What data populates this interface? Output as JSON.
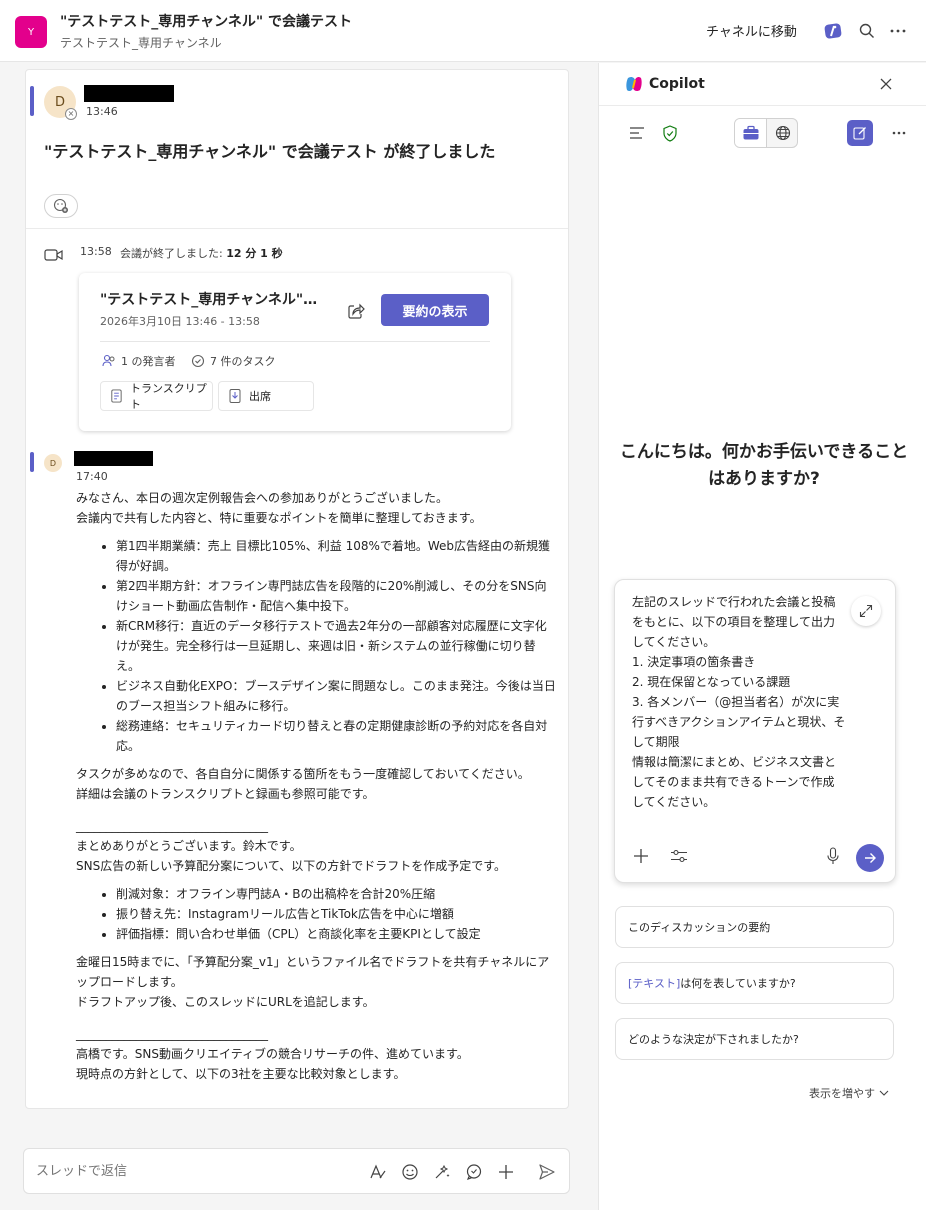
{
  "header": {
    "team_initial": "Y",
    "title": "\"テストテスト_専用チャンネル\" で会議テスト",
    "subtitle": "テストテスト_専用チャンネル",
    "goto_channel": "チャネルに移動"
  },
  "thread": {
    "post1": {
      "avatar_initial": "D",
      "time": "13:46",
      "title": "\"テストテスト_専用チャンネル\" で会議テスト が終了しました"
    },
    "meeting": {
      "time": "13:58",
      "ended_prefix": "会議が終了しました: ",
      "duration": "12 分 1 秒",
      "card": {
        "title": "\"テストテスト_専用チャンネル\" で会議テスト",
        "date": "2026年3月10日 13:46 - 13:58",
        "summary_button": "要約の表示",
        "speakers": "1 の発言者",
        "tasks": "7 件のタスク",
        "transcript": "トランスクリプト",
        "attendance": "出席"
      }
    },
    "post2": {
      "avatar_initial": "D",
      "time": "17:40",
      "p1": "みなさん、本日の週次定例報告会への参加ありがとうございました。",
      "p2": "会議内で共有した内容と、特に重要なポイントを簡単に整理しておきます。",
      "bullets1": [
        "第1四半期業績：売上 目標比105%、利益 108%で着地。Web広告経由の新規獲得が好調。",
        "第2四半期方針：オフライン専門誌広告を段階的に20%削減し、その分をSNS向けショート動画広告制作・配信へ集中投下。",
        "新CRM移行：直近のデータ移行テストで過去2年分の一部顧客対応履歴に文字化けが発生。完全移行は一旦延期し、来週は旧・新システムの並行稼働に切り替え。",
        "ビジネス自動化EXPO：ブースデザイン案に問題なし。このまま発注。今後は当日のブース担当シフト組みに移行。",
        "総務連絡：セキュリティカード切り替えと春の定期健康診断の予約対応を各自対応。"
      ],
      "p3": "タスクが多めなので、各自自分に関係する箇所をもう一度確認しておいてください。",
      "p4": "詳細は会議のトランスクリプトと録画も参照可能です。",
      "divider1": "________________________________",
      "p5": "まとめありがとうございます。鈴木です。",
      "p6": "SNS広告の新しい予算配分案について、以下の方針でドラフトを作成予定です。",
      "bullets2": [
        "削減対象：オフライン専門誌A・Bの出稿枠を合計20%圧縮",
        "振り替え先：Instagramリール広告とTikTok広告を中心に増額",
        "評価指標：問い合わせ単価（CPL）と商談化率を主要KPIとして設定"
      ],
      "p7": "金曜日15時までに、「予算配分案_v1」というファイル名でドラフトを共有チャネルにアップロードします。",
      "p8": "ドラフトアップ後、このスレッドにURLを追記します。",
      "divider2": "________________________________",
      "p9": "高橋です。SNS動画クリエイティブの競合リサーチの件、進めています。",
      "p10": "現時点の方針として、以下の3社を主要な比較対象とします。"
    },
    "reply_placeholder": "スレッドで返信"
  },
  "copilot": {
    "title": "Copilot",
    "greeting": "こんにちは。何かお手伝いできることはありますか?",
    "prompt": "左記のスレッドで行われた会議と投稿をもとに、以下の項目を整理して出力してください。\n1. 決定事項の箇条書き\n2. 現在保留となっている課題\n3. 各メンバー（@担当者名）が次に実行すべきアクションアイテムと現状、そして期限\n情報は簡潔にまとめ、ビジネス文書としてそのまま共有できるトーンで作成してください。",
    "suggestion1": "このディスカッションの要約",
    "suggestion2_tag": "[テキスト]",
    "suggestion2_rest": " は何を表していますか?",
    "suggestion3": "どのような決定が下されましたか?",
    "more": "表示を増やす"
  },
  "colors": {
    "accent": "#5b5fc7",
    "team_avatar": "#e3008c"
  }
}
